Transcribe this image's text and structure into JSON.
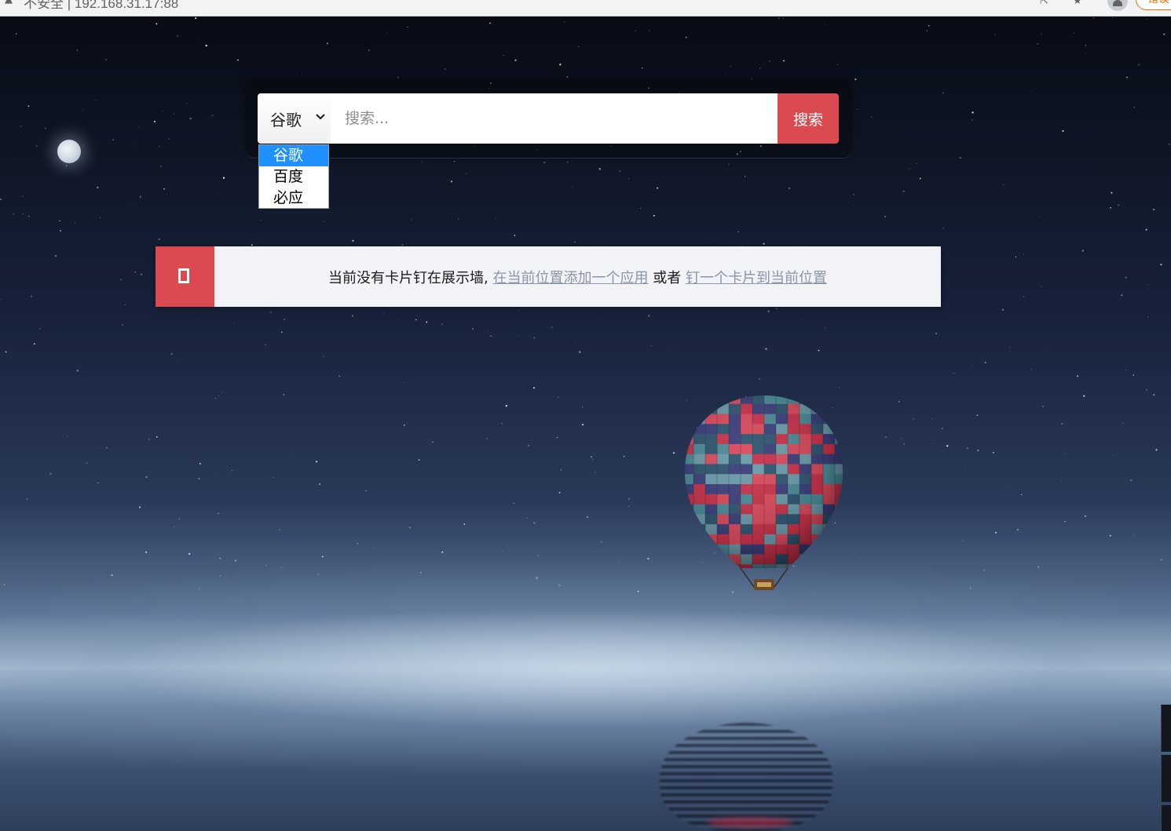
{
  "browser": {
    "security_label": "不安全",
    "address": "192.168.31.17:88",
    "update_label": "错误"
  },
  "search": {
    "engine_selected": "谷歌",
    "engines": [
      "谷歌",
      "百度",
      "必应"
    ],
    "placeholder": "搜索...",
    "button_label": "搜索"
  },
  "notice": {
    "text_before": "当前没有卡片钉在展示墙, ",
    "link_add_app": "在当前位置添加一个应用",
    "text_middle": " 或者 ",
    "link_pin_card": "钉一个卡片到当前位置",
    "icon": "card-icon"
  },
  "colors": {
    "accent": "#dc4a51",
    "dropdown_highlight": "#1e90ff",
    "notice_bg": "#f1f3f6",
    "link": "#8a95a5"
  }
}
